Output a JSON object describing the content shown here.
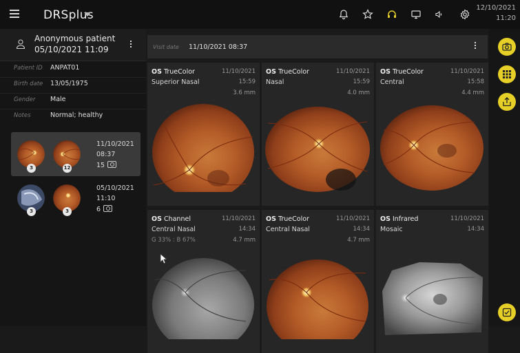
{
  "app": {
    "title": "DRSplus"
  },
  "clock": {
    "date": "12/10/2021",
    "time": "11:20"
  },
  "topbar_icons": [
    "bell-icon",
    "star-icon",
    "headset-icon",
    "monitor-icon",
    "speaker-icon",
    "gear-icon"
  ],
  "patient": {
    "name": "Anonymous patient",
    "date": "05/10/2021 11:09",
    "fields": [
      {
        "label": "Patient ID",
        "value": "ANPAT01"
      },
      {
        "label": "Birth date",
        "value": "13/05/1975"
      },
      {
        "label": "Gender",
        "value": "Male"
      },
      {
        "label": "Notes",
        "value": "Normal; healthy"
      }
    ]
  },
  "visits": [
    {
      "date": "11/10/2021",
      "time": "08:37",
      "count": "15",
      "badges": [
        "3",
        "12"
      ],
      "selected": true
    },
    {
      "date": "05/10/2021",
      "time": "11:10",
      "count": "6",
      "badges": [
        "3",
        "3"
      ],
      "selected": false
    }
  ],
  "visit_bar": {
    "label": "Visit date",
    "value": "11/10/2021 08:37"
  },
  "images": [
    {
      "eye": "OS",
      "type": "TrueColor",
      "location": "Superior Nasal",
      "extra": "",
      "date": "11/10/2021",
      "time": "15:59",
      "distance": "3.6 mm",
      "style": "color"
    },
    {
      "eye": "OS",
      "type": "TrueColor",
      "location": "Nasal",
      "extra": "",
      "date": "11/10/2021",
      "time": "15:59",
      "distance": "4.0 mm",
      "style": "color"
    },
    {
      "eye": "OS",
      "type": "TrueColor",
      "location": "Central",
      "extra": "",
      "date": "11/10/2021",
      "time": "15:58",
      "distance": "4.4 mm",
      "style": "color"
    },
    {
      "eye": "OS",
      "type": "Channel",
      "location": "Central Nasal",
      "extra": "G 33% : B 67%",
      "date": "11/10/2021",
      "time": "14:34",
      "distance": "4.7 mm",
      "style": "gray"
    },
    {
      "eye": "OS",
      "type": "TrueColor",
      "location": "Central Nasal",
      "extra": "",
      "date": "11/10/2021",
      "time": "14:34",
      "distance": "4.7 mm",
      "style": "color"
    },
    {
      "eye": "OS",
      "type": "Infrared",
      "location": "Mosaic",
      "extra": "",
      "date": "11/10/2021",
      "time": "14:34",
      "distance": "",
      "style": "ir"
    }
  ],
  "actions": [
    "camera-icon",
    "grid-icon",
    "share-icon",
    "check-icon"
  ],
  "colors": {
    "accent": "#e6cf27",
    "headset": "#e6cf27"
  }
}
